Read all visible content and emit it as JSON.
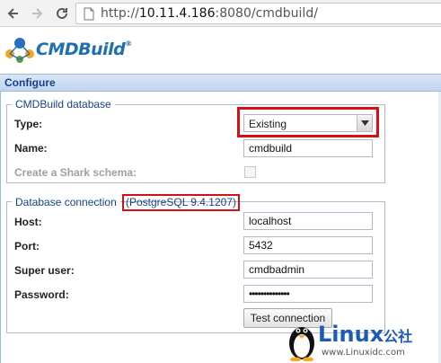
{
  "browser": {
    "url_scheme": "http://",
    "url_host": "10.11.4.186",
    "url_rest": ":8080/cmdbuild/"
  },
  "app": {
    "logo_text": "CMDBuild",
    "logo_registered": "®"
  },
  "panel": {
    "title": "Configure"
  },
  "cmdbuild_db": {
    "legend": "CMDBuild database",
    "type_label": "Type:",
    "type_value": "Existing",
    "name_label": "Name:",
    "name_value": "cmdbuild",
    "shark_label": "Create a Shark schema:"
  },
  "db_connection": {
    "legend": "Database connection",
    "db_version": "(PostgreSQL 9.4.1207)",
    "host_label": "Host:",
    "host_value": "localhost",
    "port_label": "Port:",
    "port_value": "5432",
    "user_label": "Super user:",
    "user_value": "cmdbadmin",
    "password_label": "Password:",
    "password_value": "••••••••••••••",
    "test_button": "Test connection"
  },
  "watermark": {
    "brand": "Linux",
    "brand_cn": "公社",
    "url": "www.Linuxidc.com"
  },
  "colors": {
    "highlight": "#d50f14",
    "panel_title": "#15428b",
    "logo": "#1f6fb3"
  }
}
